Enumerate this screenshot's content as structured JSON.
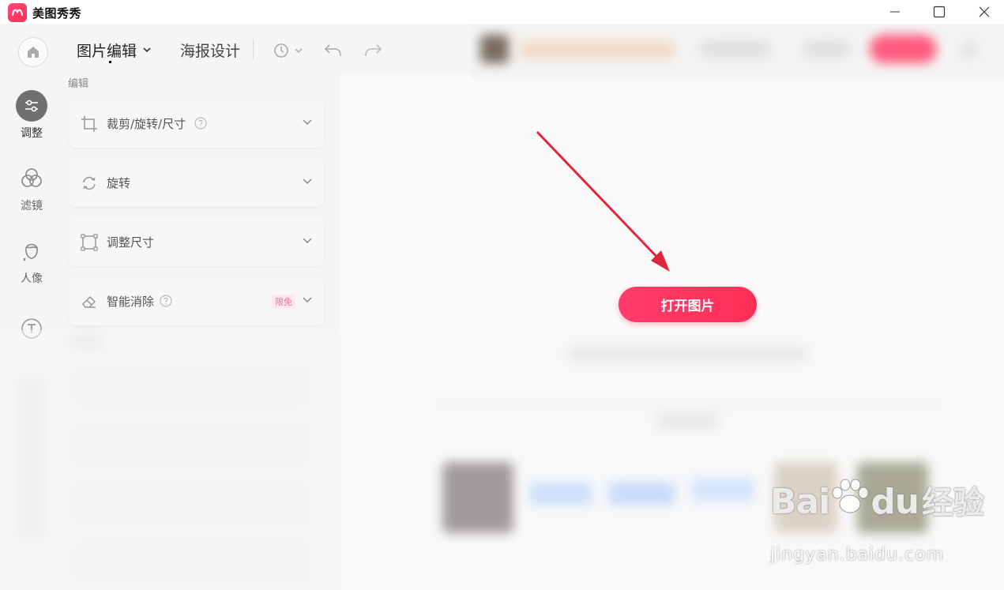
{
  "window": {
    "app_title": "美图秀秀"
  },
  "toolbar": {
    "tab_image_edit": "图片编辑",
    "tab_poster": "海报设计"
  },
  "rail": {
    "items": [
      {
        "label": "调整",
        "icon": "sliders-icon"
      },
      {
        "label": "滤镜",
        "icon": "filter-circles-icon"
      },
      {
        "label": "人像",
        "icon": "portrait-icon"
      }
    ]
  },
  "panel": {
    "section_label": "编辑",
    "cards": [
      {
        "label": "裁剪/旋转/尺寸",
        "icon": "crop-icon",
        "has_help": true
      },
      {
        "label": "旋转",
        "icon": "rotate-icon"
      },
      {
        "label": "调整尺寸",
        "icon": "resize-icon"
      },
      {
        "label": "智能消除",
        "icon": "eraser-icon",
        "has_help": true,
        "badge": "限免"
      }
    ]
  },
  "workspace": {
    "open_button": "打开图片"
  },
  "watermark": {
    "brand": "Bai",
    "brand2": "du",
    "cn": "经验",
    "url": "jingyan.baidu.com"
  },
  "colors": {
    "accent": "#ff2d55",
    "arrow": "#e0263a"
  }
}
